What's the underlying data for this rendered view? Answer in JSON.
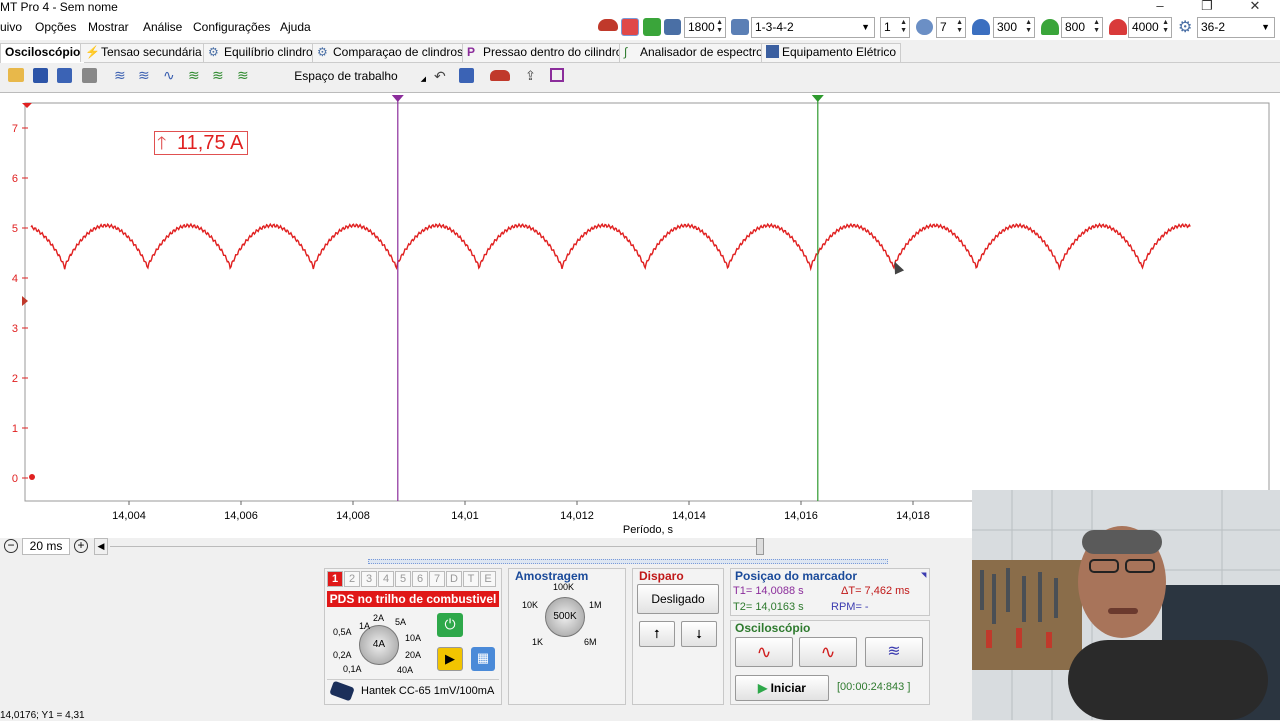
{
  "window": {
    "title": "MT Pro 4 - Sem nome",
    "controls": [
      "–",
      "❐",
      "✕"
    ]
  },
  "menu": [
    "uivo",
    "Opções",
    "Mostrar",
    "Análise",
    "Configurações",
    "Ajuda"
  ],
  "toolbar": {
    "rpm": "1800",
    "firing_order": "1-3-4-2",
    "cylinder": "1",
    "cylinders_count": "7",
    "val_300": "300",
    "val_800": "800",
    "val_4000": "4000",
    "wheel": "36-2"
  },
  "tabs": [
    "Osciloscópio",
    "Tensao secundária",
    "Equilíbrio clindro",
    "Comparaçao de clindros",
    "Pressao dentro do cilindro",
    "Analisador de espectro",
    "Equipamento Elétrico"
  ],
  "workspace_label": "Espaço de trabalho",
  "plot": {
    "y_ticks": [
      "7",
      "6",
      "5",
      "4",
      "3",
      "2",
      "1",
      "0"
    ],
    "x_ticks": [
      "14,004",
      "14,006",
      "14,008",
      "14,01",
      "14,012",
      "14,014",
      "14,016",
      "14,018"
    ],
    "x_label": "Período, s",
    "peak_label": "11,75 A",
    "trace_color": "#e02020",
    "cursor1_color": "#8b2d9b",
    "cursor2_color": "#2e9a2e",
    "cursor1_time": 14.0088,
    "cursor2_time": 14.0163
  },
  "time_scale": "20 ms",
  "channel": {
    "tabs": [
      "1",
      "2",
      "3",
      "4",
      "5",
      "6",
      "7",
      "D",
      "T",
      "E"
    ],
    "name": "PDS no trilho de combustivel",
    "knob_labels": [
      "1A",
      "2A",
      "5A",
      "10A",
      "20A",
      "40A",
      "0,5A",
      "0,2A",
      "0,1A"
    ],
    "knob_value": "4A",
    "probe": "Hantek CC-65 1mV/100mA"
  },
  "sampling": {
    "title": "Amostragem",
    "labels": [
      "100K",
      "10K",
      "1M",
      "1K",
      "6M"
    ],
    "value": "500K"
  },
  "trigger": {
    "title": "Disparo",
    "mode": "Desligado"
  },
  "marker": {
    "title": "Posiçao do marcador",
    "t1": "T1= 14,0088 s",
    "t2": "T2= 14,0163 s",
    "dt": "ΔT= 7,462 ms",
    "rpm": "RPM= -"
  },
  "scope": {
    "title": "Osciloscópio",
    "start": "Iniciar",
    "timer": "[00:00:24:843 ]"
  },
  "status": "14,0176; Y1 = 4,31"
}
